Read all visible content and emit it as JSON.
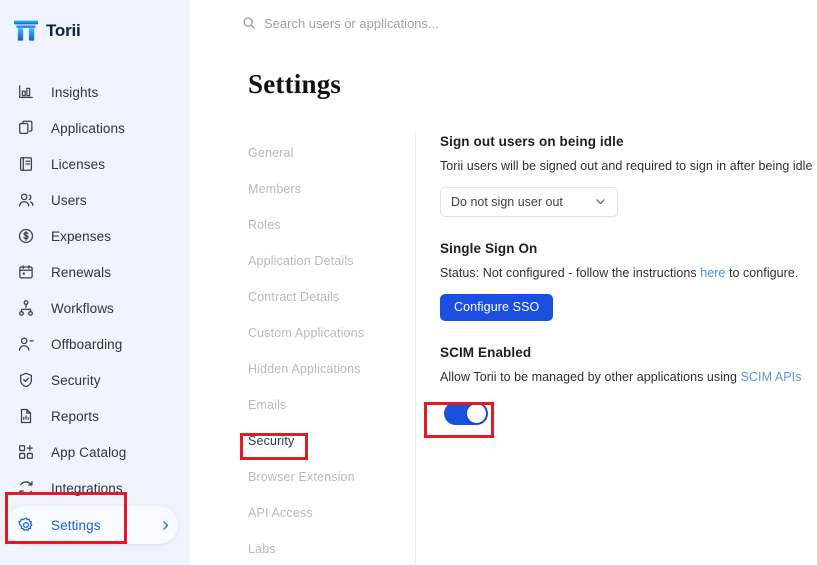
{
  "brand": {
    "name": "Torii",
    "logo_icon": "torii-gate-logo"
  },
  "search": {
    "placeholder": "Search users or applications...",
    "value": "",
    "icon": "search-icon"
  },
  "page": {
    "title": "Settings"
  },
  "colors": {
    "sidebar_bg": "#eef3fc",
    "accent_blue": "#1b4fe0",
    "active_nav_blue": "#1b5fd9",
    "annotation_red": "#e01b22",
    "link_blue": "#4a8fe0"
  },
  "sidebar": {
    "items": [
      {
        "label": "Insights",
        "icon": "bar-chart-icon",
        "active": false
      },
      {
        "label": "Applications",
        "icon": "copy-apps-icon",
        "active": false
      },
      {
        "label": "Licenses",
        "icon": "license-doc-icon",
        "active": false
      },
      {
        "label": "Users",
        "icon": "users-icon",
        "active": false
      },
      {
        "label": "Expenses",
        "icon": "dollar-circle-icon",
        "active": false
      },
      {
        "label": "Renewals",
        "icon": "calendar-icon",
        "active": false
      },
      {
        "label": "Workflows",
        "icon": "workflow-tree-icon",
        "active": false
      },
      {
        "label": "Offboarding",
        "icon": "user-minus-icon",
        "active": false
      },
      {
        "label": "Security",
        "icon": "shield-check-icon",
        "active": false
      },
      {
        "label": "Reports",
        "icon": "report-doc-icon",
        "active": false
      },
      {
        "label": "App Catalog",
        "icon": "grid-plus-icon",
        "active": false
      },
      {
        "label": "Integrations",
        "icon": "refresh-sync-icon",
        "active": false
      },
      {
        "label": "Settings",
        "icon": "gear-icon",
        "active": true,
        "chevron_icon": "chevron-right-icon"
      }
    ]
  },
  "settings_nav": {
    "items": [
      {
        "label": "General",
        "selected": false
      },
      {
        "label": "Members",
        "selected": false
      },
      {
        "label": "Roles",
        "selected": false
      },
      {
        "label": "Application Details",
        "selected": false
      },
      {
        "label": "Contract Details",
        "selected": false
      },
      {
        "label": "Custom Applications",
        "selected": false
      },
      {
        "label": "Hidden Applications",
        "selected": false
      },
      {
        "label": "Emails",
        "selected": false
      },
      {
        "label": "Security",
        "selected": true
      },
      {
        "label": "Browser Extension",
        "selected": false
      },
      {
        "label": "API Access",
        "selected": false
      },
      {
        "label": "Labs",
        "selected": false
      }
    ]
  },
  "security_panel": {
    "idle_signout": {
      "title": "Sign out users on being idle",
      "description": "Torii users will be signed out and required to sign in after being idle",
      "select_value": "Do not sign user out",
      "caret_icon": "chevron-down-icon"
    },
    "sso": {
      "title": "Single Sign On",
      "status_prefix": "Status: Not configured - follow the instructions ",
      "status_link": "here",
      "status_suffix": " to configure.",
      "button_label": "Configure SSO"
    },
    "scim": {
      "title": "SCIM Enabled",
      "description_prefix": "Allow Torii to be managed by other applications using ",
      "description_link": "SCIM APIs",
      "toggle_state": "on"
    }
  }
}
